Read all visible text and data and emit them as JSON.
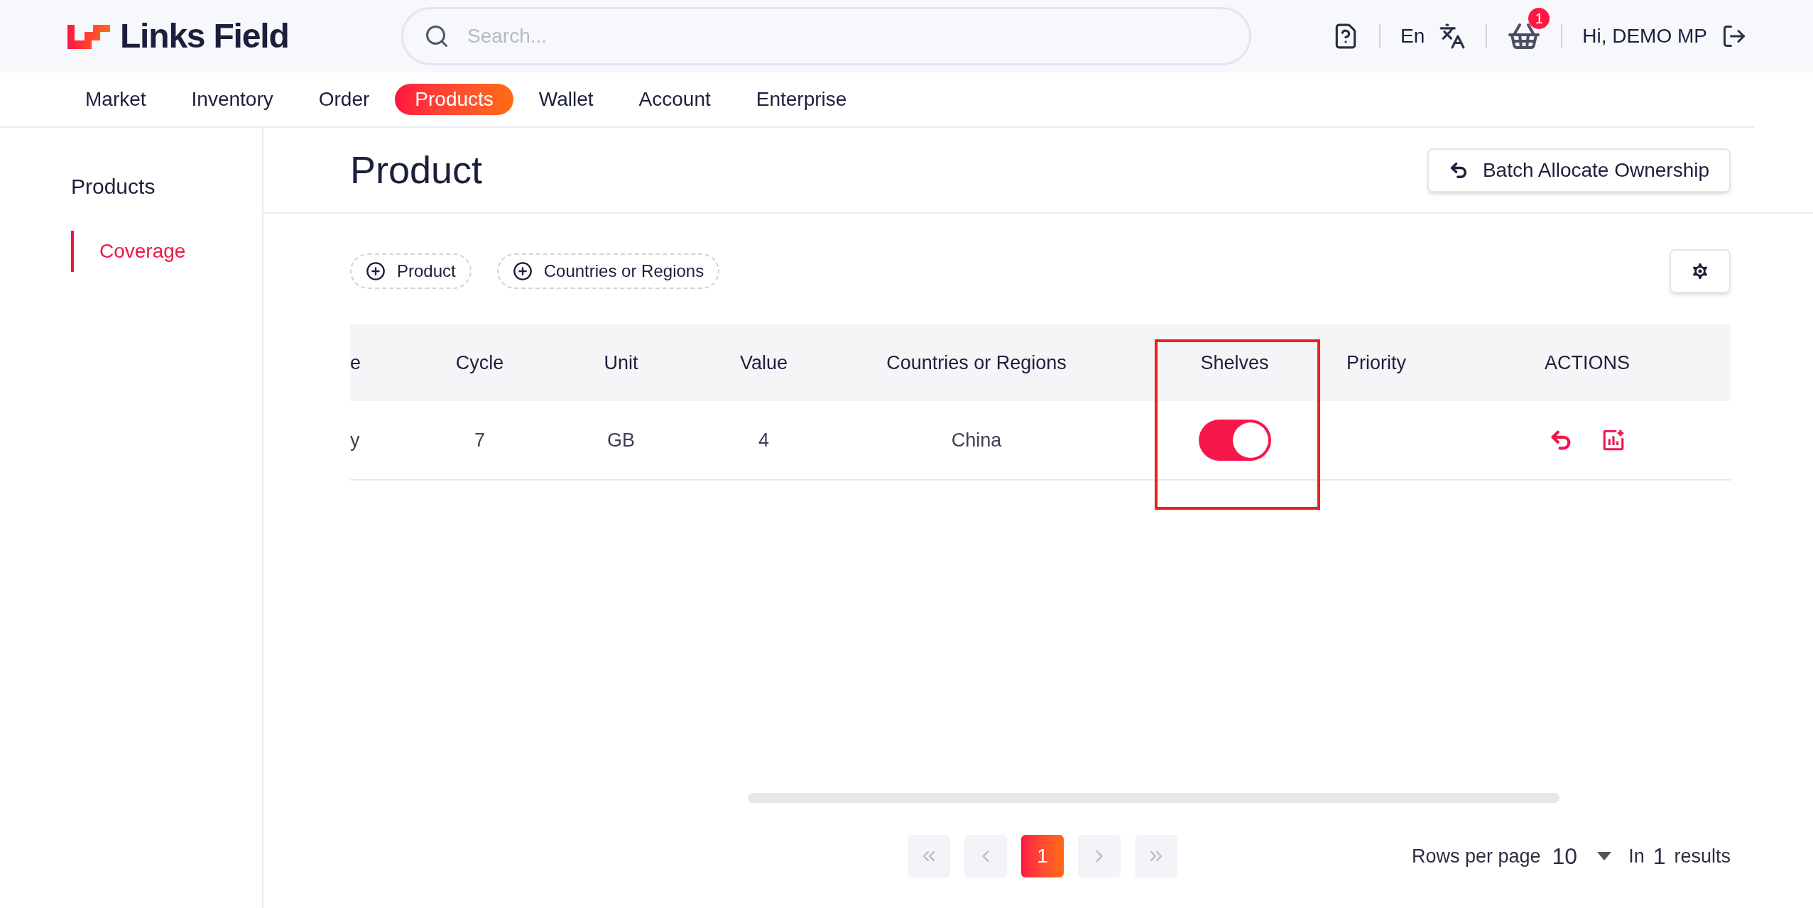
{
  "header": {
    "logo": "Links Field",
    "search": {
      "placeholder": "Search..."
    },
    "language": "En",
    "cart_count": "1",
    "user": "Hi, DEMO MP"
  },
  "nav": [
    {
      "label": "Market",
      "selected": false
    },
    {
      "label": "Inventory",
      "selected": false
    },
    {
      "label": "Order",
      "selected": false
    },
    {
      "label": "Products",
      "selected": true
    },
    {
      "label": "Wallet",
      "selected": false
    },
    {
      "label": "Account",
      "selected": false
    },
    {
      "label": "Enterprise",
      "selected": false
    }
  ],
  "sidebar": {
    "title": "Products",
    "items": [
      {
        "label": "Coverage",
        "selected": true
      }
    ]
  },
  "page": {
    "title": "Product",
    "batch_button": "Batch Allocate Ownership"
  },
  "filters": [
    "Product",
    "Countries or Regions"
  ],
  "table": {
    "columns": [
      "e",
      "Cycle",
      "Unit",
      "Value",
      "Countries or Regions",
      "",
      "Shelves",
      "Priority",
      "ACTIONS"
    ],
    "rows": [
      {
        "cells": [
          "y",
          "7",
          "GB",
          "4",
          "China"
        ],
        "shelves_on": true,
        "priority": ""
      }
    ]
  },
  "pagination": {
    "pages": [
      {
        "label": "1",
        "selected": true
      }
    ],
    "rows_label": "Rows per page",
    "rows_value": "10",
    "in_label": "In",
    "total": "1",
    "results_label": "results"
  }
}
